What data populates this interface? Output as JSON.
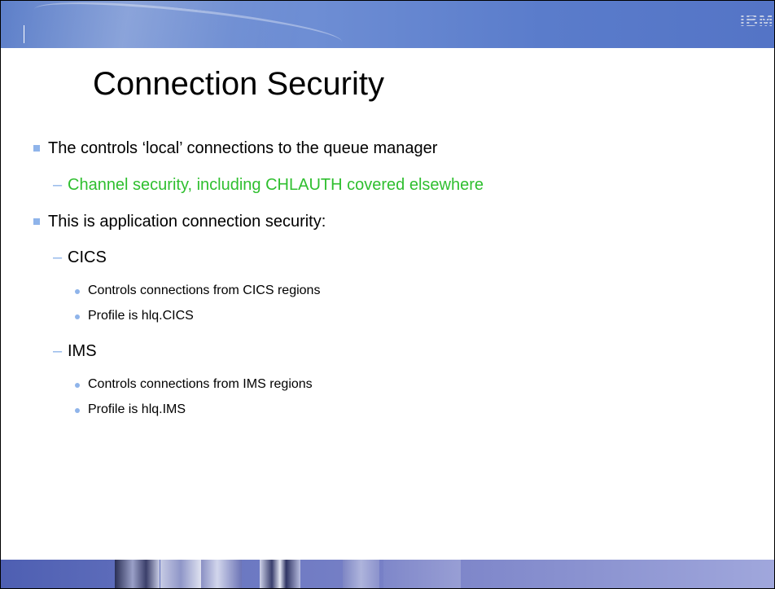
{
  "header": {
    "logo_text": "IBM"
  },
  "slide": {
    "title": "Connection Security",
    "bullets": [
      {
        "level": 1,
        "text": "The controls ‘local’ connections to the queue manager"
      },
      {
        "level": 2,
        "text": "Channel security, including CHLAUTH covered elsewhere",
        "color": "#2fbf2f"
      },
      {
        "level": 1,
        "text": "This is application connection security:"
      },
      {
        "level": 2,
        "text": "CICS"
      },
      {
        "level": 3,
        "text": "Controls connections from CICS regions"
      },
      {
        "level": 3,
        "text": "Profile is hlq.CICS"
      },
      {
        "level": 2,
        "text": "IMS"
      },
      {
        "level": 3,
        "text": "Controls connections from IMS regions"
      },
      {
        "level": 3,
        "text": "Profile is hlq.IMS"
      }
    ]
  },
  "colors": {
    "header_bar": "#6e8ed4",
    "bullet": "#8fb4ea",
    "highlight_text": "#2fbf2f",
    "footer_bar": "#6b78c2"
  },
  "icons": {
    "logo": "ibm-logo",
    "bullet_l1": "square-bullet",
    "bullet_l2": "dash-bullet",
    "bullet_l3": "dot-bullet"
  }
}
